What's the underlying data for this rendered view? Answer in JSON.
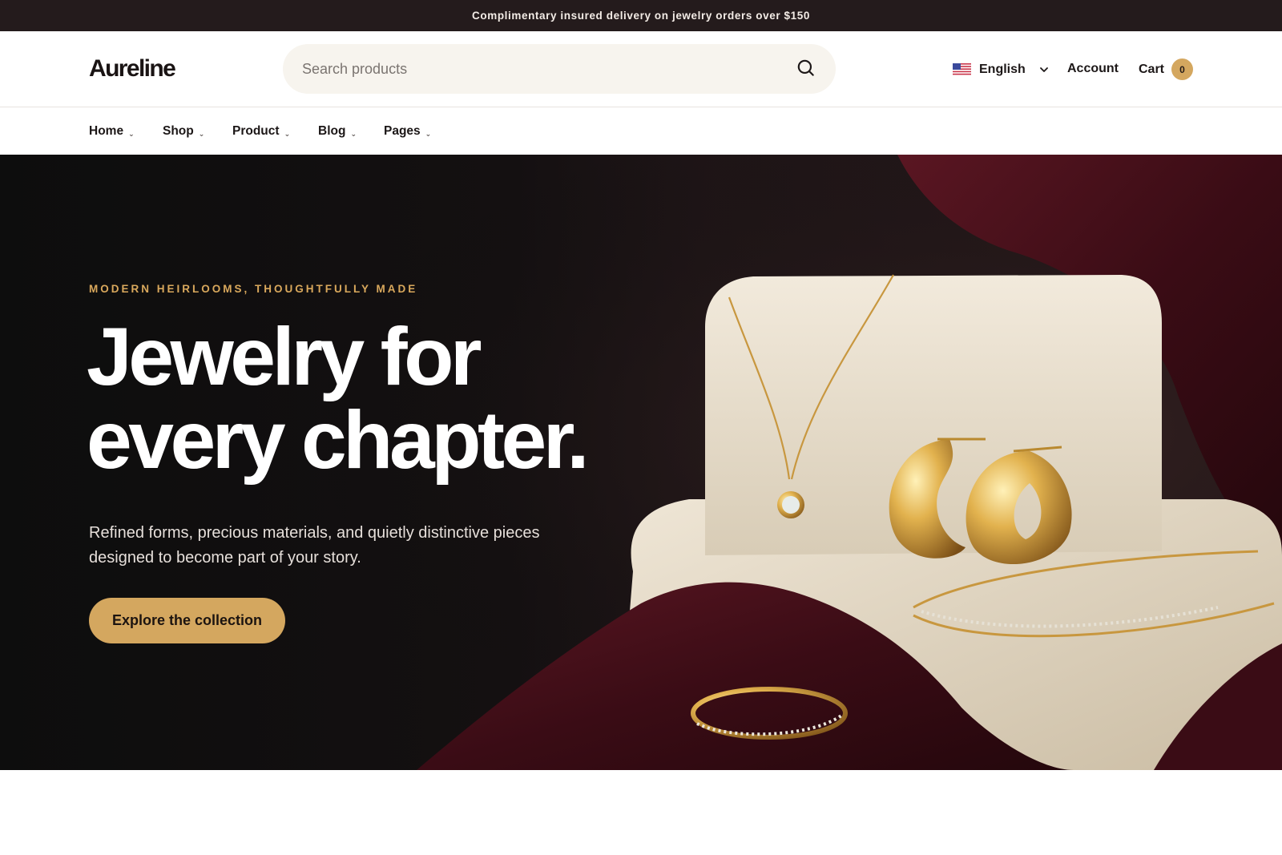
{
  "announcement": {
    "text": "Complimentary insured delivery on jewelry orders over $150"
  },
  "header": {
    "logo": "Aureline",
    "search": {
      "placeholder": "Search products",
      "icon": "search-icon"
    },
    "language": {
      "label": "English",
      "flag": "us-flag-icon"
    },
    "account_label": "Account",
    "cart": {
      "label": "Cart",
      "count": "0"
    }
  },
  "nav": {
    "items": [
      {
        "label": "Home"
      },
      {
        "label": "Shop"
      },
      {
        "label": "Product"
      },
      {
        "label": "Blog"
      },
      {
        "label": "Pages"
      }
    ]
  },
  "hero": {
    "eyebrow": "MODERN HEIRLOOMS, THOUGHTFULLY MADE",
    "title_line1": "Jewelry for",
    "title_line2": "every chapter.",
    "subtitle": "Refined forms, precious materials, and quietly distinctive pieces designed to become part of your story.",
    "cta_label": "Explore the collection"
  },
  "colors": {
    "announcement_bg": "#241b1c",
    "accent_gold": "#d4a75f",
    "hero_bg": "#0d0d0d",
    "velvet": "#4a121c",
    "stone": "#e9dfcf"
  }
}
